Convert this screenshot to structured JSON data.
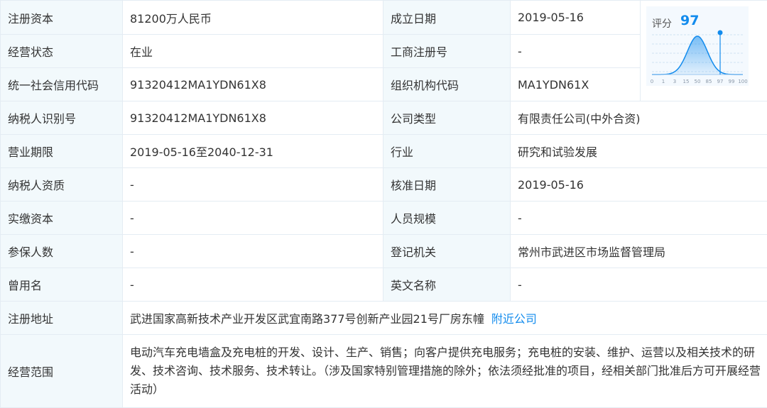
{
  "rows": [
    {
      "l1": "注册资本",
      "v1": "81200万人民币",
      "l2": "成立日期",
      "v2": "2019-05-16"
    },
    {
      "l1": "经营状态",
      "v1": "在业",
      "l2": "工商注册号",
      "v2": "-"
    },
    {
      "l1": "统一社会信用代码",
      "v1": "91320412MA1YDN61X8",
      "l2": "组织机构代码",
      "v2": "MA1YDN61X"
    },
    {
      "l1": "纳税人识别号",
      "v1": "91320412MA1YDN61X8",
      "l2": "公司类型",
      "v2": "有限责任公司(中外合资)"
    },
    {
      "l1": "营业期限",
      "v1": "2019-05-16至2040-12-31",
      "l2": "行业",
      "v2": "研究和试验发展"
    },
    {
      "l1": "纳税人资质",
      "v1": "-",
      "l2": "核准日期",
      "v2": "2019-05-16"
    },
    {
      "l1": "实缴资本",
      "v1": "-",
      "l2": "人员规模",
      "v2": "-"
    },
    {
      "l1": "参保人数",
      "v1": "-",
      "l2": "登记机关",
      "v2": "常州市武进区市场监督管理局"
    },
    {
      "l1": "曾用名",
      "v1": "-",
      "l2": "英文名称",
      "v2": "-"
    }
  ],
  "address": {
    "label": "注册地址",
    "value": "武进国家高新技术产业开发区武宜南路377号创新产业园21号厂房东幢",
    "link": "附近公司"
  },
  "scope": {
    "label": "经营范围",
    "value": "电动汽车充电墙盒及充电桩的开发、设计、生产、销售；向客户提供充电服务；充电桩的安装、维护、运营以及相关技术的研发、技术咨询、技术服务、技术转让。（涉及国家特别管理措施的除外；依法须经批准的项目，经相关部门批准后方可开展经营活动）"
  },
  "score": {
    "label": "评分",
    "value": "97",
    "ticks": [
      "0",
      "1",
      "3",
      "15",
      "50",
      "85",
      "97",
      "99",
      "100"
    ],
    "marker_value": 97,
    "color": "#128bed"
  }
}
